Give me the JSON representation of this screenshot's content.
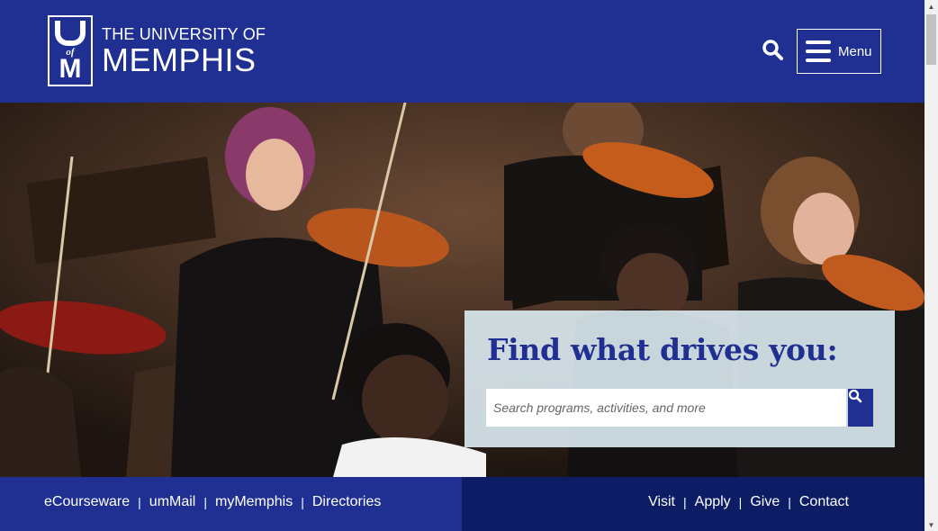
{
  "header": {
    "logo_line1": "THE UNIVERSITY OF",
    "logo_line2": "MEMPHIS",
    "logo_mark": {
      "u": "U",
      "of": "of",
      "m": "M"
    },
    "menu_label": "Menu"
  },
  "hero": {
    "title": "Find what drives you:",
    "search_placeholder": "Search programs, activities, and more"
  },
  "footer": {
    "left_links": [
      "eCourseware",
      "umMail",
      "myMemphis",
      "Directories"
    ],
    "right_links": [
      "Visit",
      "Apply",
      "Give",
      "Contact"
    ],
    "separator": "|"
  },
  "colors": {
    "brand_blue": "#1f3092",
    "dark_blue": "#0c1c65",
    "panel_bg": "#ddecf3"
  },
  "icons": [
    "search-icon",
    "hamburger-icon",
    "scroll-up-arrow",
    "scroll-down-arrow"
  ]
}
